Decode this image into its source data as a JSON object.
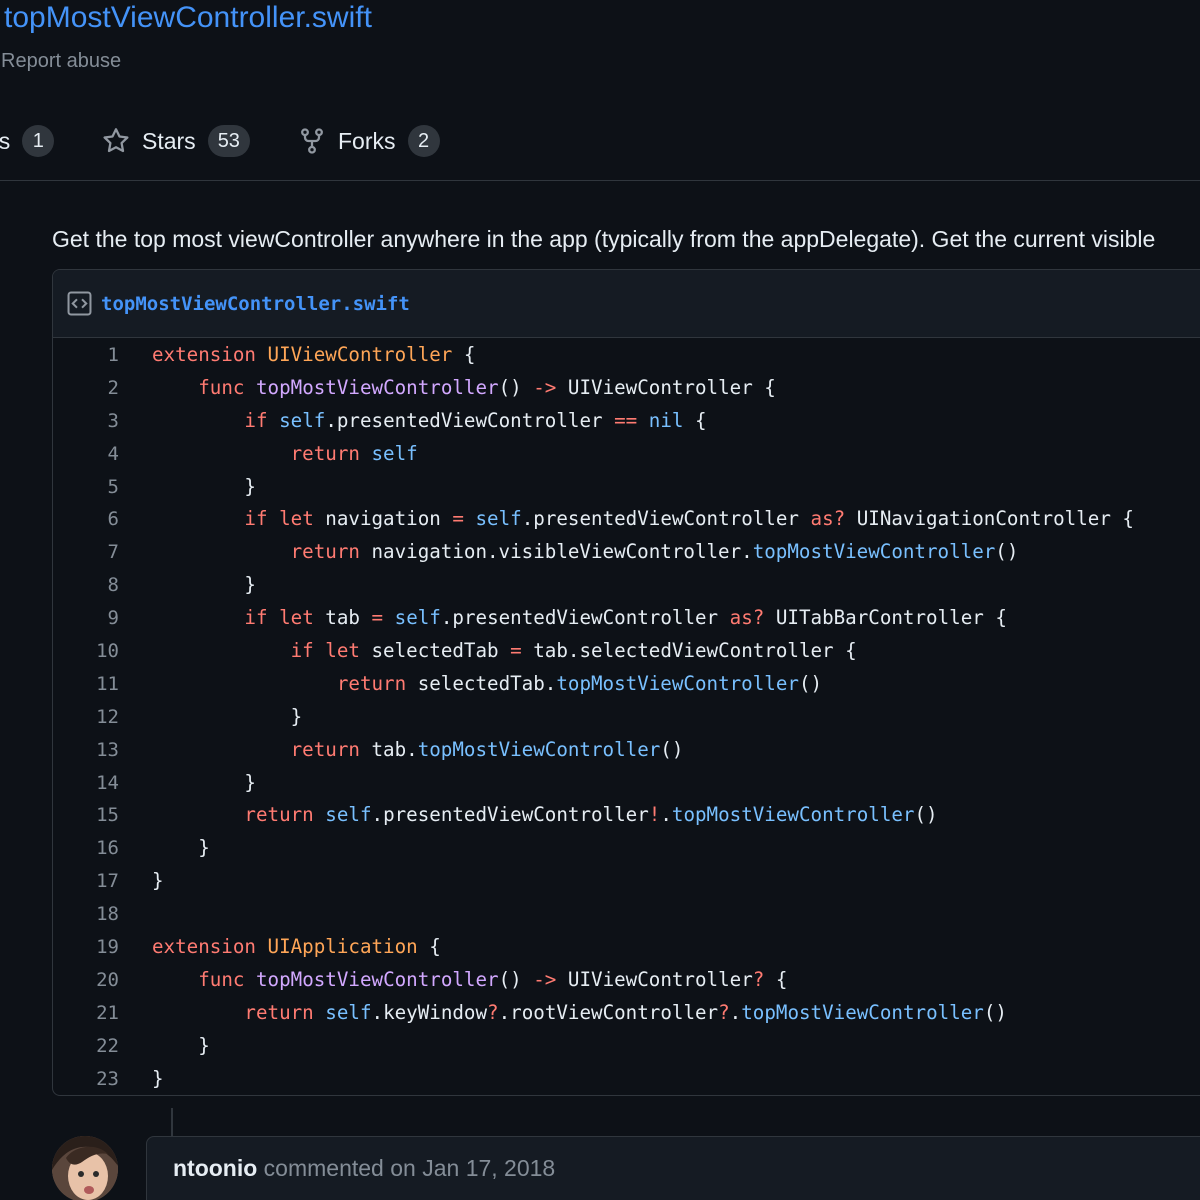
{
  "gist": {
    "title": "topMostViewController.swift",
    "report_label": "Report abuse"
  },
  "counters": [
    {
      "label": "ns",
      "count": "1",
      "icon": "eye-icon"
    },
    {
      "label": "Stars",
      "count": "53",
      "icon": "star-icon"
    },
    {
      "label": "Forks",
      "count": "2",
      "icon": "repo-forked-icon"
    }
  ],
  "description": "Get the top most viewController anywhere in the app (typically from the appDelegate). Get the current visible",
  "file": {
    "name": "topMostViewController.swift",
    "icon": "code-square-icon",
    "lines": [
      [
        [
          "kw",
          "extension"
        ],
        [
          "pl",
          " "
        ],
        [
          "ty",
          "UIViewController"
        ],
        [
          "pl",
          " {"
        ]
      ],
      [
        [
          "pl",
          "    "
        ],
        [
          "kw",
          "func"
        ],
        [
          "pl",
          " "
        ],
        [
          "fn",
          "topMostViewController"
        ],
        [
          "pl",
          "() "
        ],
        [
          "kw",
          "->"
        ],
        [
          "pl",
          " UIViewController {"
        ]
      ],
      [
        [
          "pl",
          "        "
        ],
        [
          "kw",
          "if"
        ],
        [
          "pl",
          " "
        ],
        [
          "bi",
          "self"
        ],
        [
          "pl",
          ".presentedViewController "
        ],
        [
          "kw",
          "=="
        ],
        [
          "pl",
          " "
        ],
        [
          "bi",
          "nil"
        ],
        [
          "pl",
          " {"
        ]
      ],
      [
        [
          "pl",
          "            "
        ],
        [
          "kw",
          "return"
        ],
        [
          "pl",
          " "
        ],
        [
          "bi",
          "self"
        ]
      ],
      [
        [
          "pl",
          "        }"
        ]
      ],
      [
        [
          "pl",
          "        "
        ],
        [
          "kw",
          "if"
        ],
        [
          "pl",
          " "
        ],
        [
          "kw",
          "let"
        ],
        [
          "pl",
          " navigation "
        ],
        [
          "kw",
          "="
        ],
        [
          "pl",
          " "
        ],
        [
          "bi",
          "self"
        ],
        [
          "pl",
          ".presentedViewController "
        ],
        [
          "kw",
          "as?"
        ],
        [
          "pl",
          " UINavigationController {"
        ]
      ],
      [
        [
          "pl",
          "            "
        ],
        [
          "kw",
          "return"
        ],
        [
          "pl",
          " navigation.visibleViewController."
        ],
        [
          "call",
          "topMostViewController"
        ],
        [
          "pl",
          "()"
        ]
      ],
      [
        [
          "pl",
          "        }"
        ]
      ],
      [
        [
          "pl",
          "        "
        ],
        [
          "kw",
          "if"
        ],
        [
          "pl",
          " "
        ],
        [
          "kw",
          "let"
        ],
        [
          "pl",
          " tab "
        ],
        [
          "kw",
          "="
        ],
        [
          "pl",
          " "
        ],
        [
          "bi",
          "self"
        ],
        [
          "pl",
          ".presentedViewController "
        ],
        [
          "kw",
          "as?"
        ],
        [
          "pl",
          " UITabBarController {"
        ]
      ],
      [
        [
          "pl",
          "            "
        ],
        [
          "kw",
          "if"
        ],
        [
          "pl",
          " "
        ],
        [
          "kw",
          "let"
        ],
        [
          "pl",
          " selectedTab "
        ],
        [
          "kw",
          "="
        ],
        [
          "pl",
          " tab.selectedViewController {"
        ]
      ],
      [
        [
          "pl",
          "                "
        ],
        [
          "kw",
          "return"
        ],
        [
          "pl",
          " selectedTab."
        ],
        [
          "call",
          "topMostViewController"
        ],
        [
          "pl",
          "()"
        ]
      ],
      [
        [
          "pl",
          "            }"
        ]
      ],
      [
        [
          "pl",
          "            "
        ],
        [
          "kw",
          "return"
        ],
        [
          "pl",
          " tab."
        ],
        [
          "call",
          "topMostViewController"
        ],
        [
          "pl",
          "()"
        ]
      ],
      [
        [
          "pl",
          "        }"
        ]
      ],
      [
        [
          "pl",
          "        "
        ],
        [
          "kw",
          "return"
        ],
        [
          "pl",
          " "
        ],
        [
          "bi",
          "self"
        ],
        [
          "pl",
          ".presentedViewController"
        ],
        [
          "kw",
          "!"
        ],
        [
          "pl",
          "."
        ],
        [
          "call",
          "topMostViewController"
        ],
        [
          "pl",
          "()"
        ]
      ],
      [
        [
          "pl",
          "    }"
        ]
      ],
      [
        [
          "pl",
          "}"
        ]
      ],
      [],
      [
        [
          "kw",
          "extension"
        ],
        [
          "pl",
          " "
        ],
        [
          "ty",
          "UIApplication"
        ],
        [
          "pl",
          " {"
        ]
      ],
      [
        [
          "pl",
          "    "
        ],
        [
          "kw",
          "func"
        ],
        [
          "pl",
          " "
        ],
        [
          "fn",
          "topMostViewController"
        ],
        [
          "pl",
          "() "
        ],
        [
          "kw",
          "->"
        ],
        [
          "pl",
          " UIViewController"
        ],
        [
          "kw",
          "?"
        ],
        [
          "pl",
          " {"
        ]
      ],
      [
        [
          "pl",
          "        "
        ],
        [
          "kw",
          "return"
        ],
        [
          "pl",
          " "
        ],
        [
          "bi",
          "self"
        ],
        [
          "pl",
          ".keyWindow"
        ],
        [
          "kw",
          "?"
        ],
        [
          "pl",
          ".rootViewController"
        ],
        [
          "kw",
          "?"
        ],
        [
          "pl",
          "."
        ],
        [
          "call",
          "topMostViewController"
        ],
        [
          "pl",
          "()"
        ]
      ],
      [
        [
          "pl",
          "    }"
        ]
      ],
      [
        [
          "pl",
          "}"
        ]
      ]
    ]
  },
  "comment": {
    "author": "ntoonio",
    "action": " commented on Jan 17, 2018"
  },
  "colors": {
    "background": "#0d1117",
    "link": "#4493f8",
    "keyword": "#ff7b72",
    "type": "#ffa657",
    "function": "#d2a8ff",
    "builtin": "#79c0ff"
  }
}
